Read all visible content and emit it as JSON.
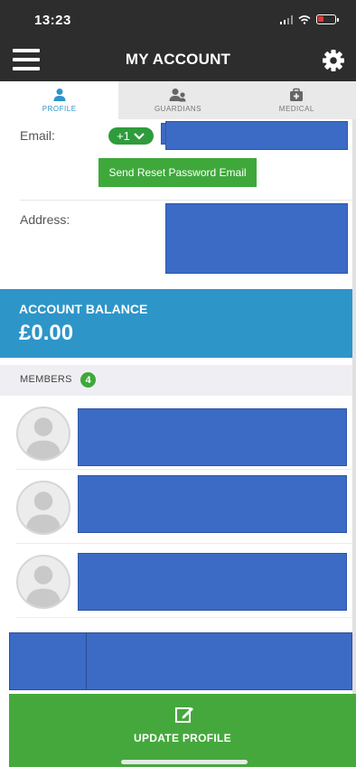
{
  "status_bar": {
    "time": "13:23"
  },
  "header": {
    "title": "MY ACCOUNT"
  },
  "tabs": [
    {
      "label": "PROFILE",
      "icon": "person-icon",
      "active": true
    },
    {
      "label": "GUARDIANS",
      "icon": "guardians-icon",
      "active": false
    },
    {
      "label": "MEDICAL",
      "icon": "medical-kit-icon",
      "active": false
    }
  ],
  "profile": {
    "email_label": "Email:",
    "country_code": "+1",
    "reset_button_label": "Send Reset Password Email",
    "address_label": "Address:"
  },
  "account_balance": {
    "label": "ACCOUNT BALANCE",
    "value": "£0.00"
  },
  "members": {
    "label": "MEMBERS",
    "count": "4"
  },
  "footer": {
    "button_label": "UPDATE PROFILE"
  },
  "colors": {
    "dark_header": "#2d2d2d",
    "accent_blue": "#2e95c9",
    "accent_green": "#3fa83b",
    "redaction_blue": "#3c6bc6"
  }
}
